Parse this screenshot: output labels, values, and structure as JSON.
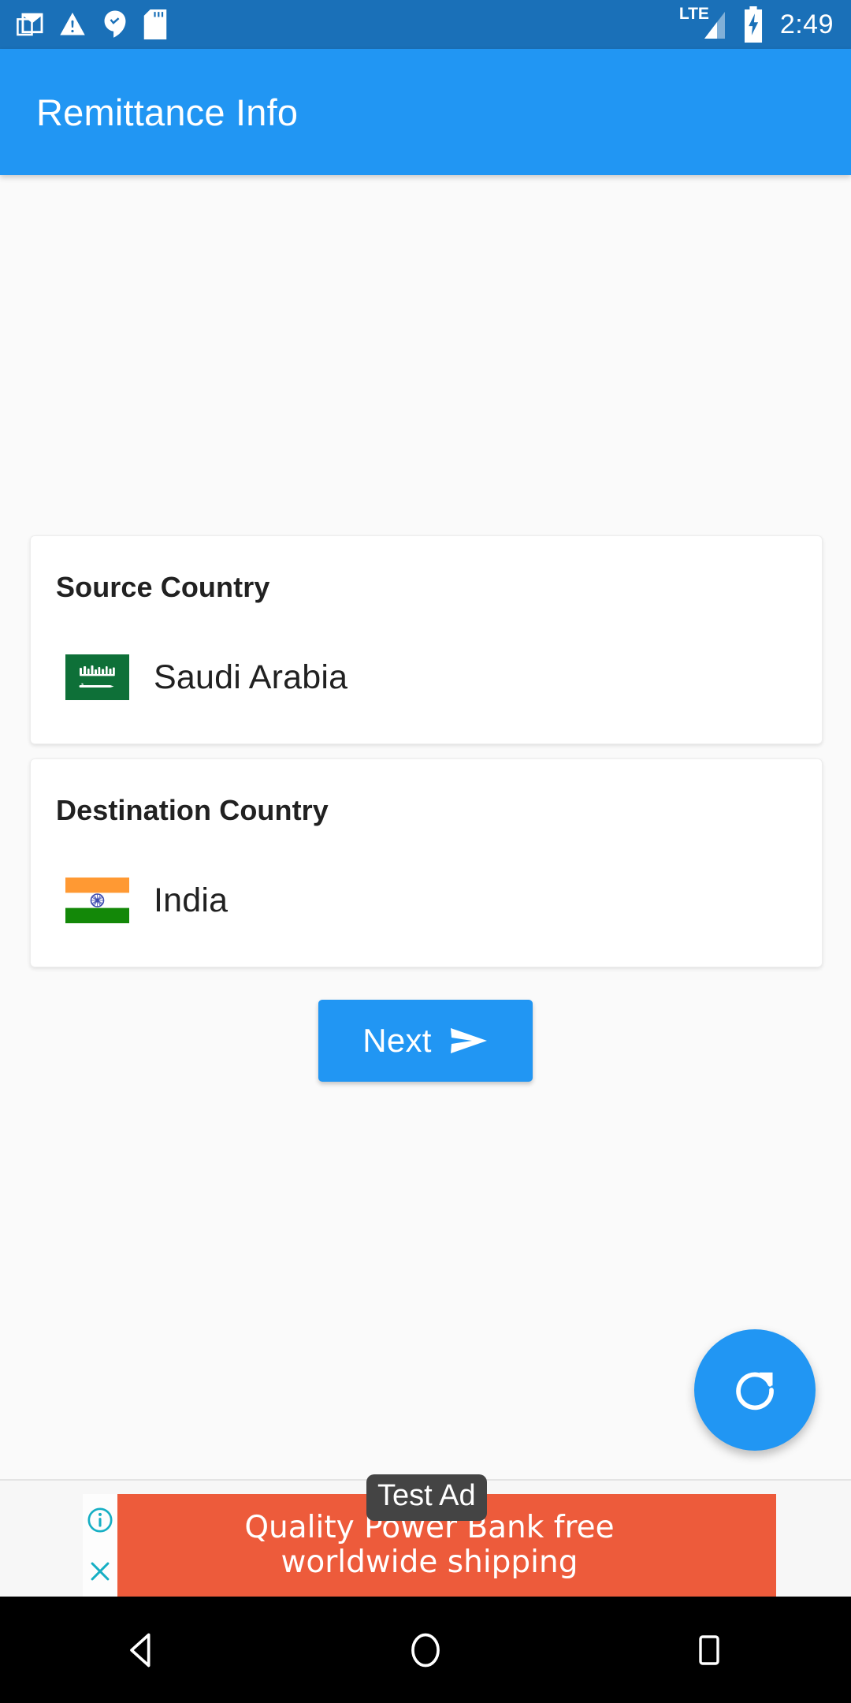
{
  "status_bar": {
    "icons": [
      "gmail-icon",
      "warning-icon",
      "hangouts-icon",
      "sd-card-icon"
    ],
    "network_label": "LTE",
    "battery": "charging",
    "clock": "2:49",
    "background_color": "#1A70B8"
  },
  "app_bar": {
    "title": "Remittance Info",
    "background_color": "#2196F3"
  },
  "main": {
    "source_card": {
      "label": "Source Country",
      "country": "Saudi Arabia",
      "flag": "saudi-arabia-flag",
      "flag_colors": {
        "field": "#0E7038",
        "emblem": "#FFFFFF"
      }
    },
    "destination_card": {
      "label": "Destination Country",
      "country": "India",
      "flag": "india-flag",
      "flag_colors": {
        "saffron": "#FF9933",
        "white": "#FFFFFF",
        "green": "#138808",
        "chakra": "#3F4DB0"
      }
    },
    "next_button": {
      "label": "Next",
      "icon": "send-icon",
      "background_color": "#2196F3"
    },
    "fab": {
      "icon": "refresh-icon",
      "background_color": "#2196F3"
    }
  },
  "ad": {
    "line1": "Quality Power Bank free",
    "line2": "worldwide shipping",
    "badge": "Test Ad",
    "background_color": "#ED5B3B",
    "info_icon": "info-icon",
    "close_icon": "close-icon",
    "control_color": "#16AFC4"
  },
  "nav_bar": {
    "back": "back-icon",
    "home": "home-icon",
    "recents": "recents-icon",
    "background_color": "#000000"
  }
}
